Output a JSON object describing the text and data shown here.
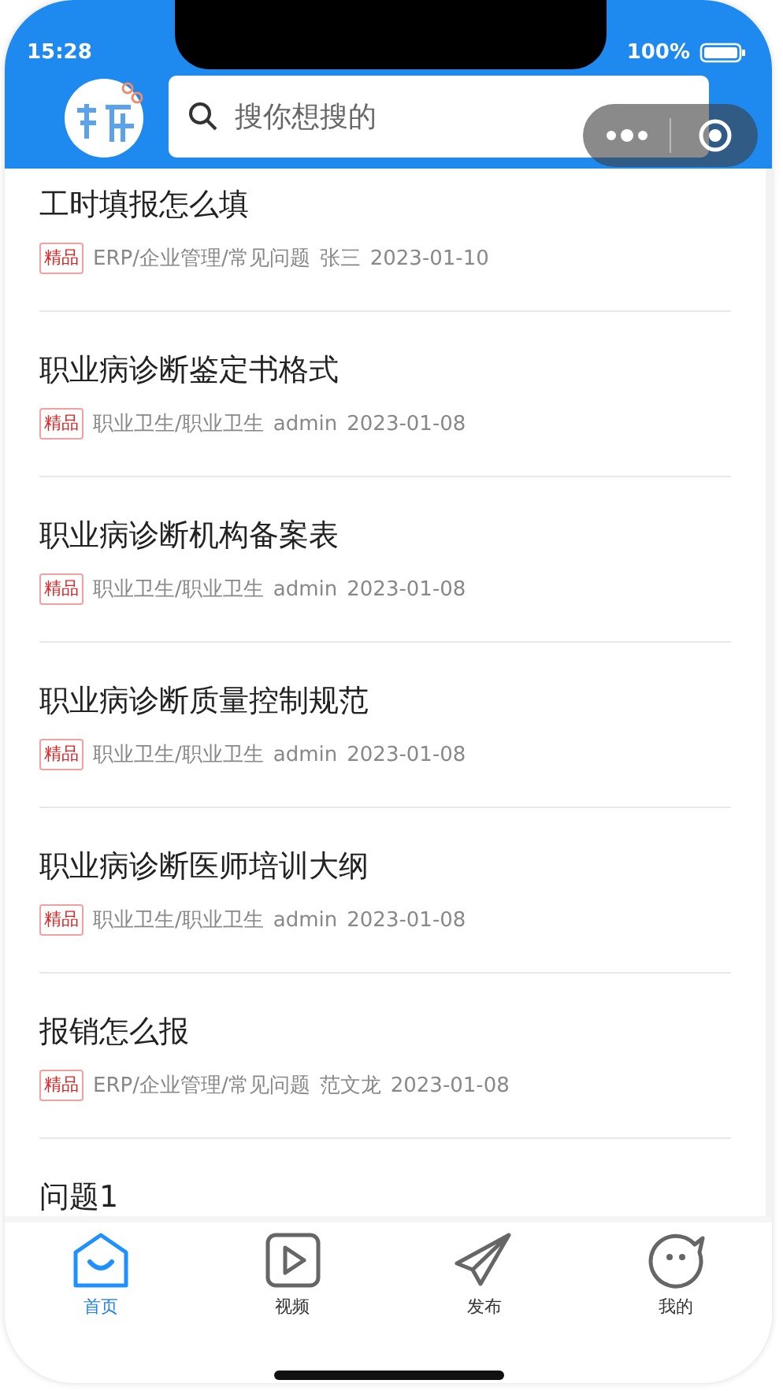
{
  "status_bar": {
    "time": "15:28",
    "battery": "100%"
  },
  "search": {
    "placeholder": "搜你想搜的"
  },
  "articles": [
    {
      "title": "工时填报怎么填",
      "tag": "精品",
      "category": "ERP/企业管理/常见问题",
      "author": "张三",
      "date": "2023-01-10"
    },
    {
      "title": "职业病诊断鉴定书格式",
      "tag": "精品",
      "category": "职业卫生/职业卫生",
      "author": "admin",
      "date": "2023-01-08"
    },
    {
      "title": "职业病诊断机构备案表",
      "tag": "精品",
      "category": "职业卫生/职业卫生",
      "author": "admin",
      "date": "2023-01-08"
    },
    {
      "title": "职业病诊断质量控制规范",
      "tag": "精品",
      "category": "职业卫生/职业卫生",
      "author": "admin",
      "date": "2023-01-08"
    },
    {
      "title": "职业病诊断医师培训大纲",
      "tag": "精品",
      "category": "职业卫生/职业卫生",
      "author": "admin",
      "date": "2023-01-08"
    },
    {
      "title": "报销怎么报",
      "tag": "精品",
      "category": "ERP/企业管理/常见问题",
      "author": "范文龙",
      "date": "2023-01-08"
    },
    {
      "title": "问题1"
    }
  ],
  "tabs": [
    {
      "label": "首页",
      "selected": true
    },
    {
      "label": "视频",
      "selected": false
    },
    {
      "label": "发布",
      "selected": false
    },
    {
      "label": "我的",
      "selected": false
    }
  ]
}
